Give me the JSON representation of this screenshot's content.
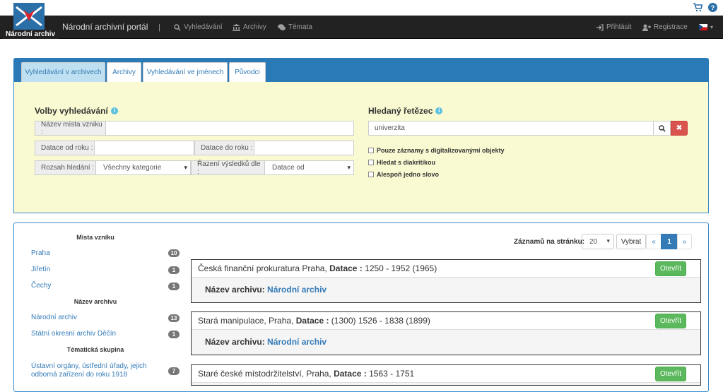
{
  "header": {
    "logo_text": "Národní archiv",
    "brand": "Národní archivní portál",
    "separator": "|",
    "nav": [
      {
        "label": "Vyhledávání",
        "icon": "search-icon"
      },
      {
        "label": "Archivy",
        "icon": "bank-icon"
      },
      {
        "label": "Témata",
        "icon": "comments-icon"
      }
    ],
    "login": "Přihlásit",
    "register": "Registrace",
    "language": "cs",
    "cart_icon": "cart-icon",
    "help_icon": "help-icon"
  },
  "tabs": [
    {
      "label": "Vyhledávání v archivech",
      "active": true
    },
    {
      "label": "Archivy",
      "active": false
    },
    {
      "label": "Vyhledávání ve jménech",
      "active": false
    },
    {
      "label": "Původci",
      "active": false
    }
  ],
  "search": {
    "options_title": "Volby vyhledávání",
    "place_label": "Název místa vzniku :",
    "place_value": "",
    "date_from_label": "Datace od roku :",
    "date_from_value": "",
    "date_to_label": "Datace do roku :",
    "date_to_value": "",
    "scope_label": "Rozsah hledání :",
    "scope_value": "Všechny kategorie",
    "sort_label": "Řazení výsledků dle :",
    "sort_value": "Datace od",
    "query_title": "Hledaný řetězec",
    "query_value": "univerzita",
    "checkboxes": [
      "Pouze záznamy s digitalizovanými objekty",
      "Hledat s diakritikou",
      "Alespoň jedno slovo"
    ]
  },
  "facets": [
    {
      "heading": "Místa vzniku",
      "items": [
        {
          "label": "Praha",
          "count": "10"
        },
        {
          "label": "Jiřetín",
          "count": "1"
        },
        {
          "label": "Čechy",
          "count": "1"
        }
      ]
    },
    {
      "heading": "Název archivu",
      "items": [
        {
          "label": "Národní archiv",
          "count": "13"
        },
        {
          "label": "Státní okresní archiv Děčín",
          "count": "1"
        }
      ]
    },
    {
      "heading": "Tématická skupina",
      "items": [
        {
          "label": "Ústavní orgány, ústřední úřady, jejich odborná zařízení do roku 1918",
          "count": "7"
        }
      ]
    }
  ],
  "pagination": {
    "per_page_label": "Záznamů na stránku:",
    "per_page_value": "20",
    "select_button": "Vybrat",
    "prev": "«",
    "current": "1",
    "next": "»"
  },
  "results": [
    {
      "title": "Česká finanční prokuratura Praha,",
      "date_label": "Datace :",
      "date_value": "1250 - 1952 (1965)",
      "archive_label": "Název archivu:",
      "archive_value": "Národní archiv",
      "open": "Otevřít"
    },
    {
      "title": "Stará manipulace, Praha,",
      "date_label": "Datace :",
      "date_value": "(1300) 1526 - 1838 (1899)",
      "archive_label": "Název archivu:",
      "archive_value": "Národní archiv",
      "open": "Otevřít"
    },
    {
      "title": "Staré české místodržitelství, Praha,",
      "date_label": "Datace :",
      "date_value": "1563 - 1751",
      "archive_label": "",
      "archive_value": "",
      "open": "Otevřít"
    }
  ]
}
